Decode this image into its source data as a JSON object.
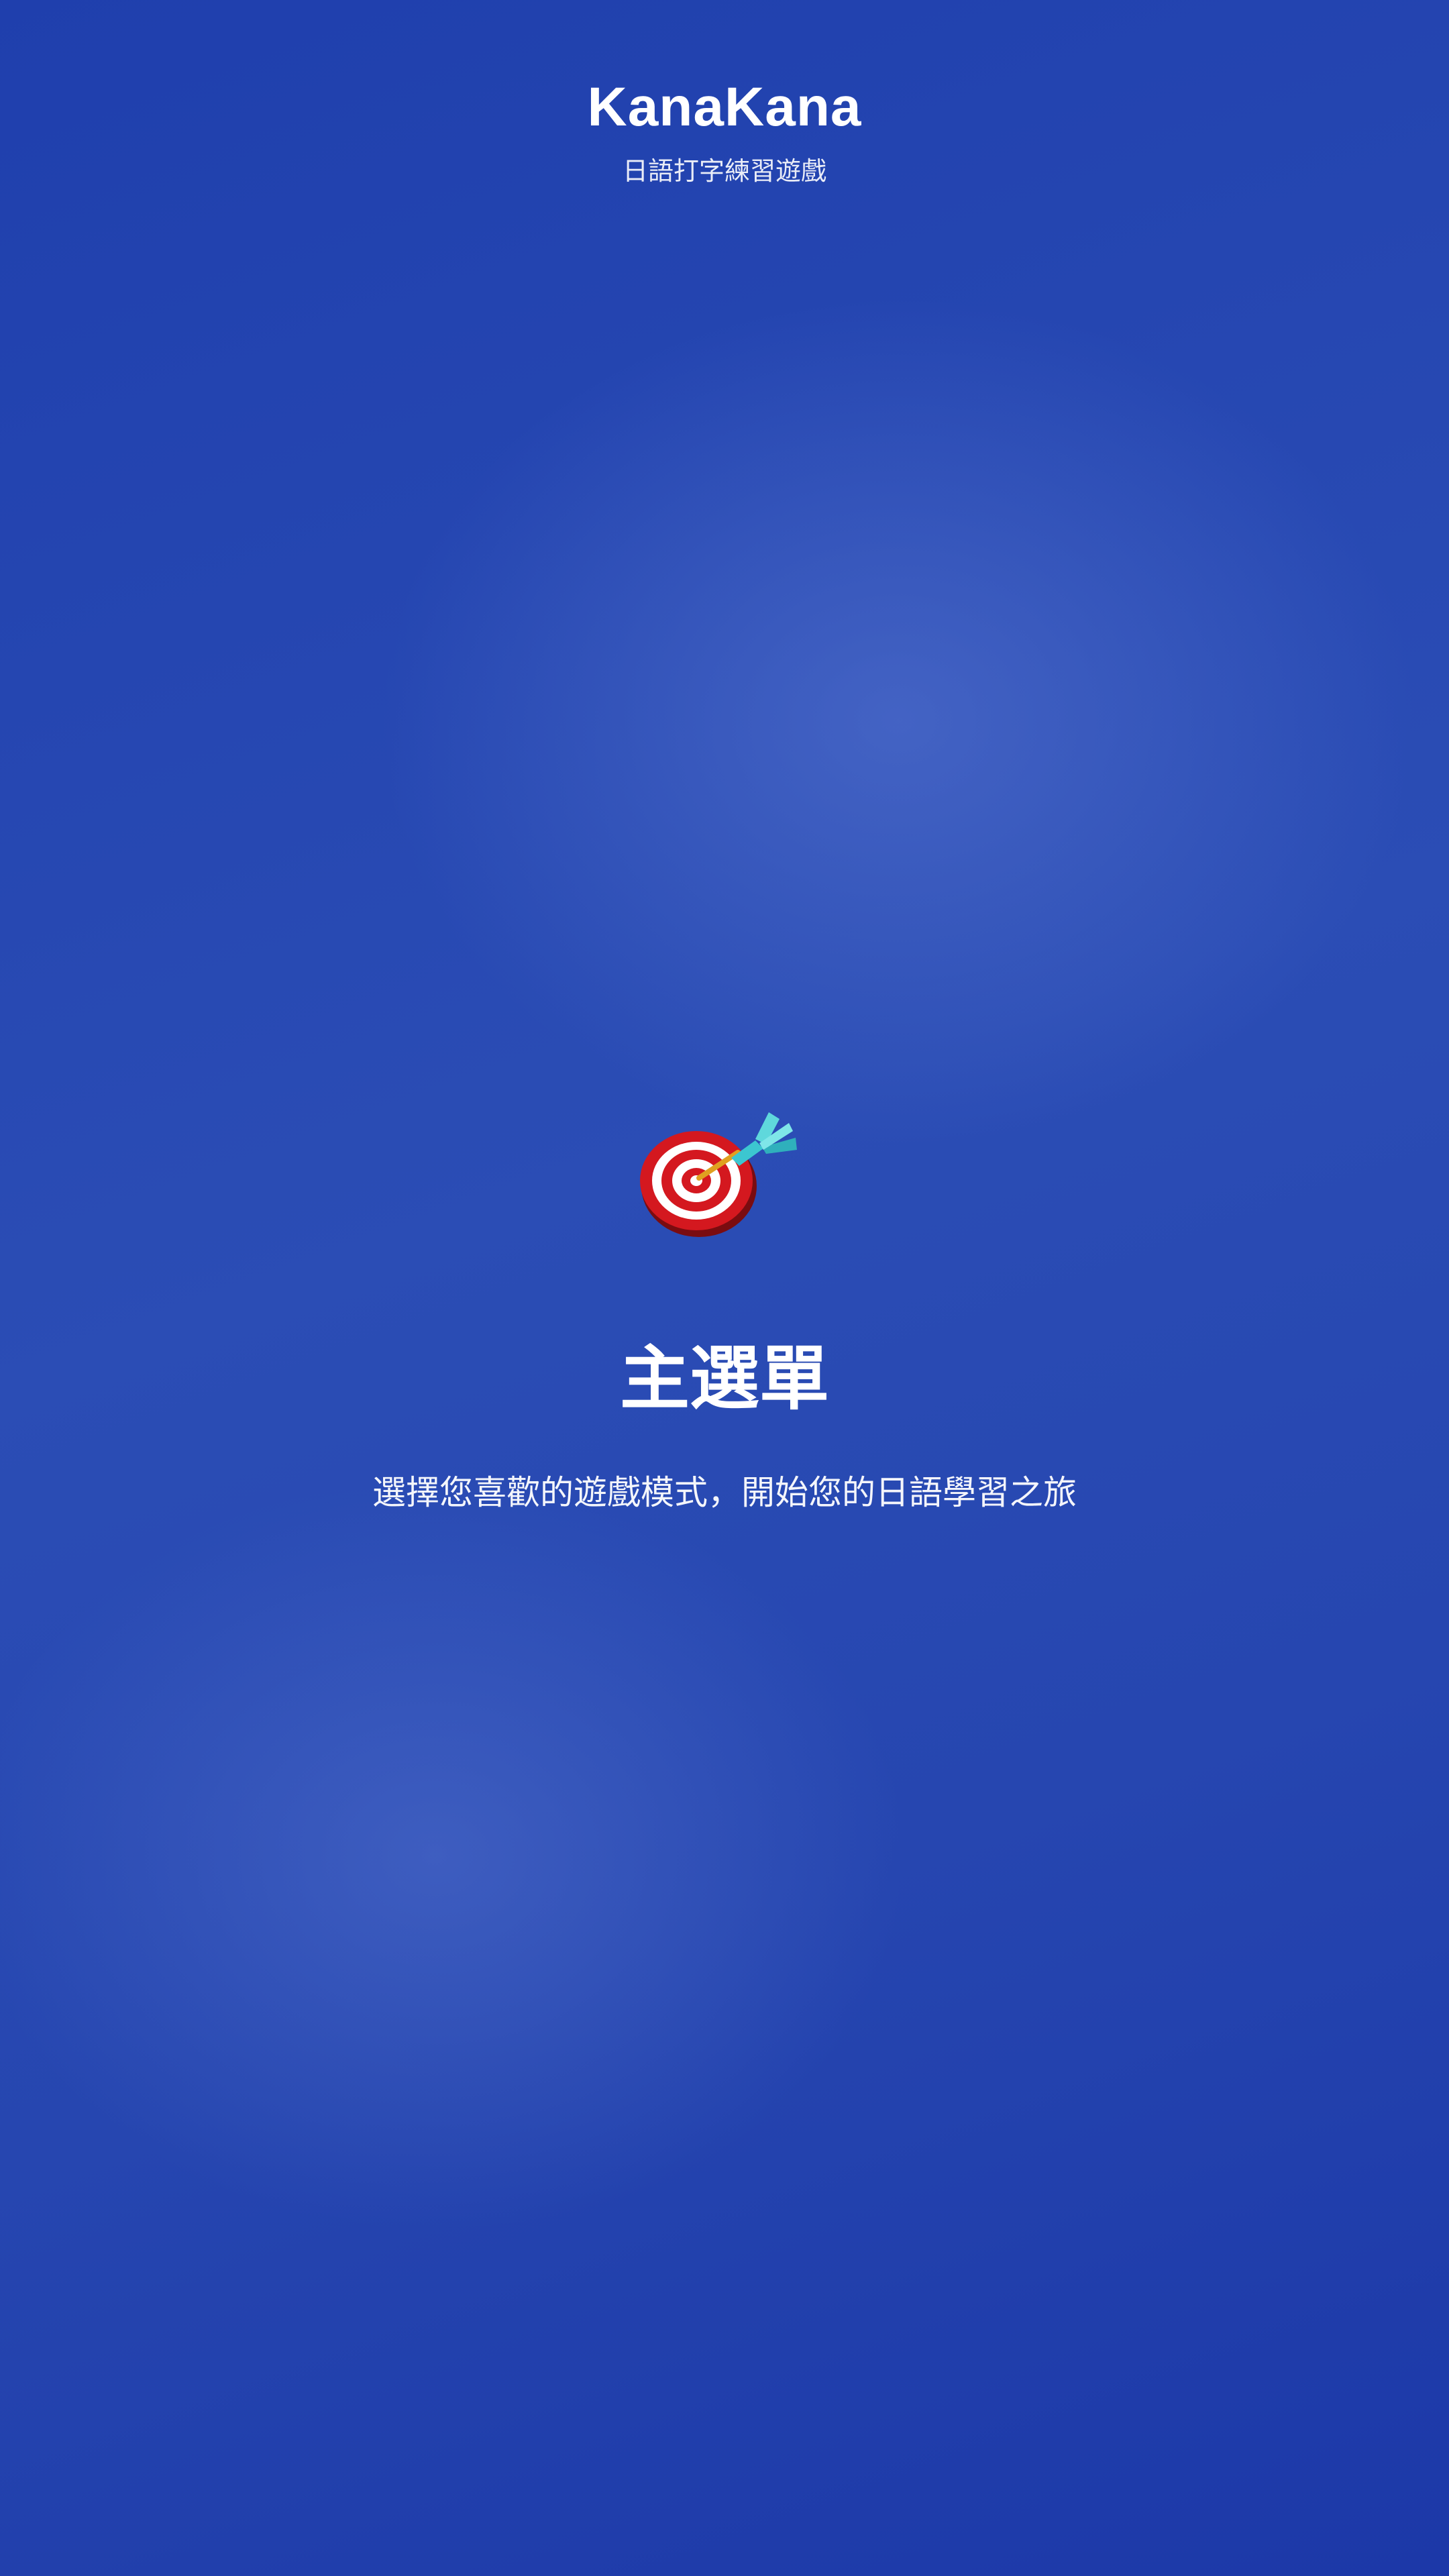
{
  "header": {
    "title": "KanaKana",
    "subtitle": "日語打字練習遊戲"
  },
  "hero": {
    "icon": "target-dart-icon",
    "title": "主選單",
    "description": "選擇您喜歡的遊戲模式，開始您的日語學習之旅"
  },
  "colors": {
    "background_top": "#1f3fad",
    "background_mid": "#2b4db5",
    "background_bottom": "#1c38a8",
    "text": "#ffffff",
    "target_red": "#c8161d",
    "dart_teal": "#3cc6d0"
  }
}
